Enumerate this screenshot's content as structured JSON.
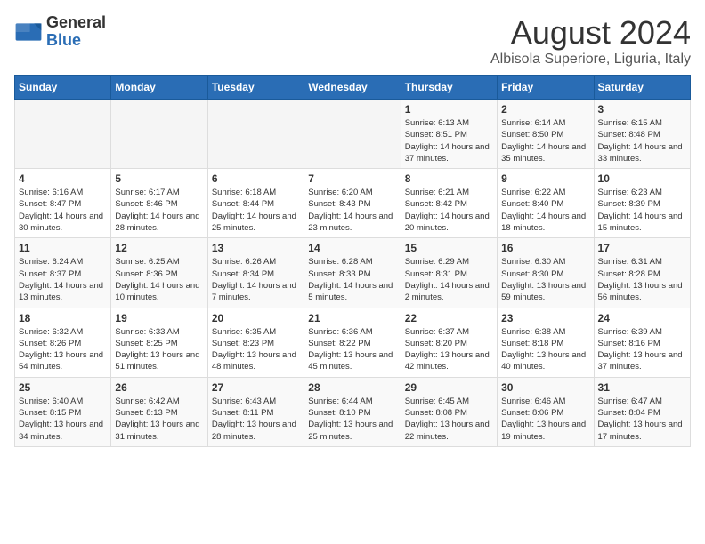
{
  "logo": {
    "general": "General",
    "blue": "Blue"
  },
  "title": "August 2024",
  "subtitle": "Albisola Superiore, Liguria, Italy",
  "days_of_week": [
    "Sunday",
    "Monday",
    "Tuesday",
    "Wednesday",
    "Thursday",
    "Friday",
    "Saturday"
  ],
  "weeks": [
    [
      {
        "day": "",
        "info": ""
      },
      {
        "day": "",
        "info": ""
      },
      {
        "day": "",
        "info": ""
      },
      {
        "day": "",
        "info": ""
      },
      {
        "day": "1",
        "info": "Sunrise: 6:13 AM\nSunset: 8:51 PM\nDaylight: 14 hours and 37 minutes."
      },
      {
        "day": "2",
        "info": "Sunrise: 6:14 AM\nSunset: 8:50 PM\nDaylight: 14 hours and 35 minutes."
      },
      {
        "day": "3",
        "info": "Sunrise: 6:15 AM\nSunset: 8:48 PM\nDaylight: 14 hours and 33 minutes."
      }
    ],
    [
      {
        "day": "4",
        "info": "Sunrise: 6:16 AM\nSunset: 8:47 PM\nDaylight: 14 hours and 30 minutes."
      },
      {
        "day": "5",
        "info": "Sunrise: 6:17 AM\nSunset: 8:46 PM\nDaylight: 14 hours and 28 minutes."
      },
      {
        "day": "6",
        "info": "Sunrise: 6:18 AM\nSunset: 8:44 PM\nDaylight: 14 hours and 25 minutes."
      },
      {
        "day": "7",
        "info": "Sunrise: 6:20 AM\nSunset: 8:43 PM\nDaylight: 14 hours and 23 minutes."
      },
      {
        "day": "8",
        "info": "Sunrise: 6:21 AM\nSunset: 8:42 PM\nDaylight: 14 hours and 20 minutes."
      },
      {
        "day": "9",
        "info": "Sunrise: 6:22 AM\nSunset: 8:40 PM\nDaylight: 14 hours and 18 minutes."
      },
      {
        "day": "10",
        "info": "Sunrise: 6:23 AM\nSunset: 8:39 PM\nDaylight: 14 hours and 15 minutes."
      }
    ],
    [
      {
        "day": "11",
        "info": "Sunrise: 6:24 AM\nSunset: 8:37 PM\nDaylight: 14 hours and 13 minutes."
      },
      {
        "day": "12",
        "info": "Sunrise: 6:25 AM\nSunset: 8:36 PM\nDaylight: 14 hours and 10 minutes."
      },
      {
        "day": "13",
        "info": "Sunrise: 6:26 AM\nSunset: 8:34 PM\nDaylight: 14 hours and 7 minutes."
      },
      {
        "day": "14",
        "info": "Sunrise: 6:28 AM\nSunset: 8:33 PM\nDaylight: 14 hours and 5 minutes."
      },
      {
        "day": "15",
        "info": "Sunrise: 6:29 AM\nSunset: 8:31 PM\nDaylight: 14 hours and 2 minutes."
      },
      {
        "day": "16",
        "info": "Sunrise: 6:30 AM\nSunset: 8:30 PM\nDaylight: 13 hours and 59 minutes."
      },
      {
        "day": "17",
        "info": "Sunrise: 6:31 AM\nSunset: 8:28 PM\nDaylight: 13 hours and 56 minutes."
      }
    ],
    [
      {
        "day": "18",
        "info": "Sunrise: 6:32 AM\nSunset: 8:26 PM\nDaylight: 13 hours and 54 minutes."
      },
      {
        "day": "19",
        "info": "Sunrise: 6:33 AM\nSunset: 8:25 PM\nDaylight: 13 hours and 51 minutes."
      },
      {
        "day": "20",
        "info": "Sunrise: 6:35 AM\nSunset: 8:23 PM\nDaylight: 13 hours and 48 minutes."
      },
      {
        "day": "21",
        "info": "Sunrise: 6:36 AM\nSunset: 8:22 PM\nDaylight: 13 hours and 45 minutes."
      },
      {
        "day": "22",
        "info": "Sunrise: 6:37 AM\nSunset: 8:20 PM\nDaylight: 13 hours and 42 minutes."
      },
      {
        "day": "23",
        "info": "Sunrise: 6:38 AM\nSunset: 8:18 PM\nDaylight: 13 hours and 40 minutes."
      },
      {
        "day": "24",
        "info": "Sunrise: 6:39 AM\nSunset: 8:16 PM\nDaylight: 13 hours and 37 minutes."
      }
    ],
    [
      {
        "day": "25",
        "info": "Sunrise: 6:40 AM\nSunset: 8:15 PM\nDaylight: 13 hours and 34 minutes."
      },
      {
        "day": "26",
        "info": "Sunrise: 6:42 AM\nSunset: 8:13 PM\nDaylight: 13 hours and 31 minutes."
      },
      {
        "day": "27",
        "info": "Sunrise: 6:43 AM\nSunset: 8:11 PM\nDaylight: 13 hours and 28 minutes."
      },
      {
        "day": "28",
        "info": "Sunrise: 6:44 AM\nSunset: 8:10 PM\nDaylight: 13 hours and 25 minutes."
      },
      {
        "day": "29",
        "info": "Sunrise: 6:45 AM\nSunset: 8:08 PM\nDaylight: 13 hours and 22 minutes."
      },
      {
        "day": "30",
        "info": "Sunrise: 6:46 AM\nSunset: 8:06 PM\nDaylight: 13 hours and 19 minutes."
      },
      {
        "day": "31",
        "info": "Sunrise: 6:47 AM\nSunset: 8:04 PM\nDaylight: 13 hours and 17 minutes."
      }
    ]
  ]
}
